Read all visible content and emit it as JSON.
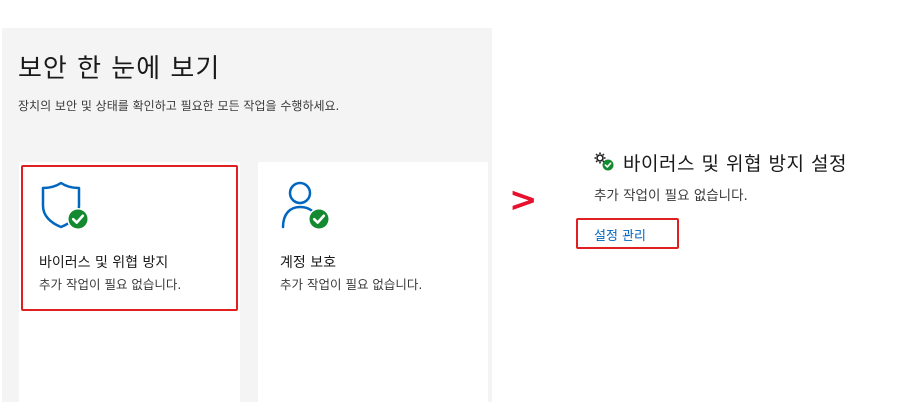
{
  "header": {
    "title": "보안 한 눈에 보기",
    "subtitle": "장치의 보안 및 상태를 확인하고 필요한 모든 작업을 수행하세요."
  },
  "cards": [
    {
      "title": "바이러스 및 위협 방지",
      "status": "추가 작업이 필요 없습니다.",
      "icon": "shield-check-icon"
    },
    {
      "title": "계정 보호",
      "status": "추가 작업이 필요 없습니다.",
      "icon": "user-check-icon"
    }
  ],
  "arrow": ">",
  "settings": {
    "icon": "gears-check-icon",
    "title": "바이러스 및 위협 방지 설정",
    "status": "추가 작업이 필요 없습니다.",
    "manage_link": "설정 관리"
  },
  "colors": {
    "accent_blue": "#0067c0",
    "status_green": "#138a2f",
    "highlight_red": "#e02020",
    "arrow_red": "#e8112d"
  }
}
